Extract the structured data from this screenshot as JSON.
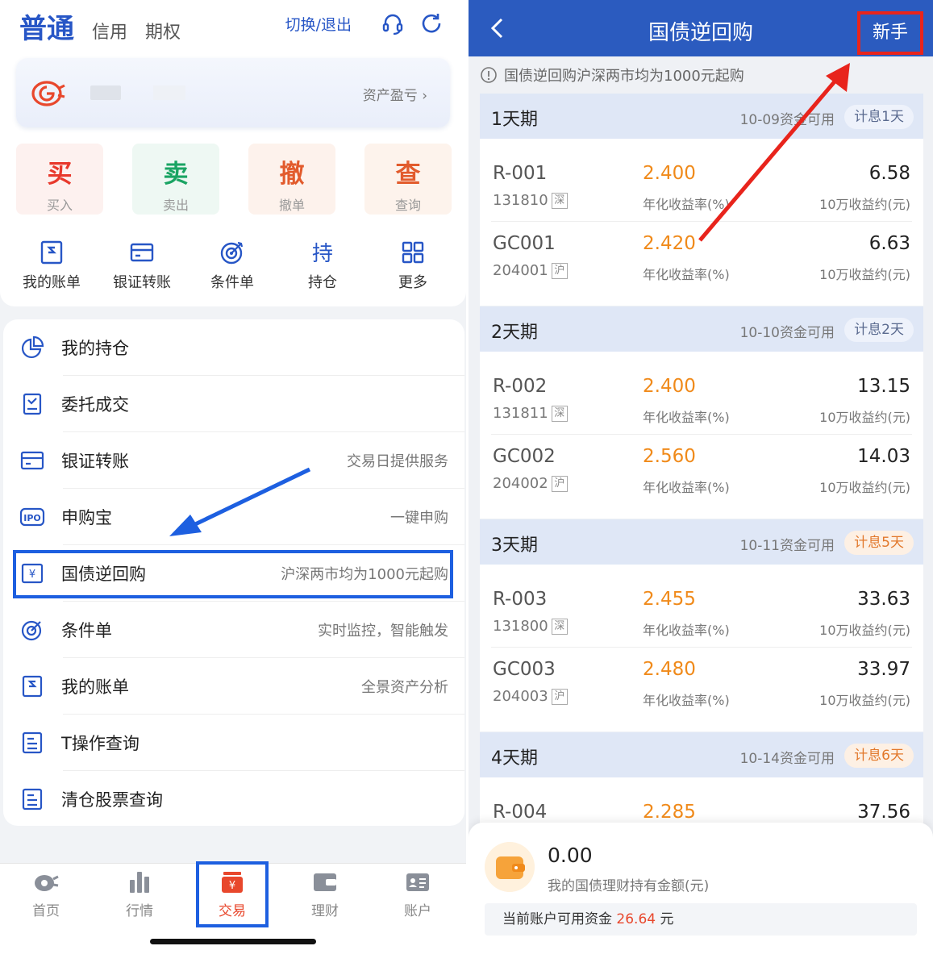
{
  "left": {
    "mode_tabs": [
      "普通",
      "信用",
      "期权"
    ],
    "switch_label": "切换/退出",
    "asset_link": "资产盈亏 ›",
    "trade_buttons": [
      {
        "big": "买",
        "small": "买入"
      },
      {
        "big": "卖",
        "small": "卖出"
      },
      {
        "big": "撤",
        "small": "撤单"
      },
      {
        "big": "查",
        "small": "查询"
      }
    ],
    "quick_items": [
      "我的账单",
      "银证转账",
      "条件单",
      "持仓",
      "更多"
    ],
    "quick_icons": [
      "bill-icon",
      "card-icon",
      "target-icon",
      "hold-icon",
      "grid-icon"
    ],
    "menu": [
      {
        "title": "我的持仓",
        "desc": "",
        "icon": "pie-chart-icon"
      },
      {
        "title": "委托成交",
        "desc": "",
        "icon": "order-icon"
      },
      {
        "title": "银证转账",
        "desc": "交易日提供服务",
        "icon": "card-icon"
      },
      {
        "title": "申购宝",
        "desc": "一键申购",
        "icon": "ipo-icon"
      },
      {
        "title": "国债逆回购",
        "desc": "沪深两市均为1000元起购",
        "icon": "bond-repo-icon"
      },
      {
        "title": "条件单",
        "desc": "实时监控，智能触发",
        "icon": "target-icon"
      },
      {
        "title": "我的账单",
        "desc": "全景资产分析",
        "icon": "bill-icon"
      },
      {
        "title": "T操作查询",
        "desc": "",
        "icon": "doc-icon"
      },
      {
        "title": "清仓股票查询",
        "desc": "",
        "icon": "doc-icon"
      }
    ],
    "nav": [
      {
        "label": "首页",
        "icon": "home-icon"
      },
      {
        "label": "行情",
        "icon": "bar-chart-icon"
      },
      {
        "label": "交易",
        "icon": "trade-icon"
      },
      {
        "label": "理财",
        "icon": "wallet-icon"
      },
      {
        "label": "账户",
        "icon": "account-icon"
      }
    ],
    "active_nav": "交易"
  },
  "right": {
    "title": "国债逆回购",
    "new_user_label": "新手",
    "notice": "国债逆回购沪深两市均为1000元起购",
    "rate_label": "年化收益率(%)",
    "value_label": "10万收益约(元)",
    "periods": [
      {
        "name": "1天期",
        "avail": "10-09资金可用",
        "badge": "计息1天",
        "warm": false,
        "items": [
          {
            "code": "R-001",
            "sub": "131810",
            "mkt": "深",
            "rate": "2.400",
            "value": "6.58"
          },
          {
            "code": "GC001",
            "sub": "204001",
            "mkt": "沪",
            "rate": "2.420",
            "value": "6.63"
          }
        ]
      },
      {
        "name": "2天期",
        "avail": "10-10资金可用",
        "badge": "计息2天",
        "warm": false,
        "items": [
          {
            "code": "R-002",
            "sub": "131811",
            "mkt": "深",
            "rate": "2.400",
            "value": "13.15"
          },
          {
            "code": "GC002",
            "sub": "204002",
            "mkt": "沪",
            "rate": "2.560",
            "value": "14.03"
          }
        ]
      },
      {
        "name": "3天期",
        "avail": "10-11资金可用",
        "badge": "计息5天",
        "warm": true,
        "items": [
          {
            "code": "R-003",
            "sub": "131800",
            "mkt": "深",
            "rate": "2.455",
            "value": "33.63"
          },
          {
            "code": "GC003",
            "sub": "204003",
            "mkt": "沪",
            "rate": "2.480",
            "value": "33.97"
          }
        ]
      },
      {
        "name": "4天期",
        "avail": "10-14资金可用",
        "badge": "计息6天",
        "warm": true,
        "items": [
          {
            "code": "R-004",
            "sub": "",
            "mkt": "",
            "rate": "2.285",
            "value": "37.56"
          }
        ]
      }
    ],
    "holding_value": "0.00",
    "holding_label": "我的国债理财持有金额(元)",
    "cash_prefix": "当前账户可用资金",
    "cash_value": "26.64",
    "cash_unit": "元"
  },
  "colors": {
    "brand_blue": "#2b5bbf",
    "accent_orange": "#f08a1a",
    "red": "#e8392c",
    "green": "#1aa463"
  }
}
